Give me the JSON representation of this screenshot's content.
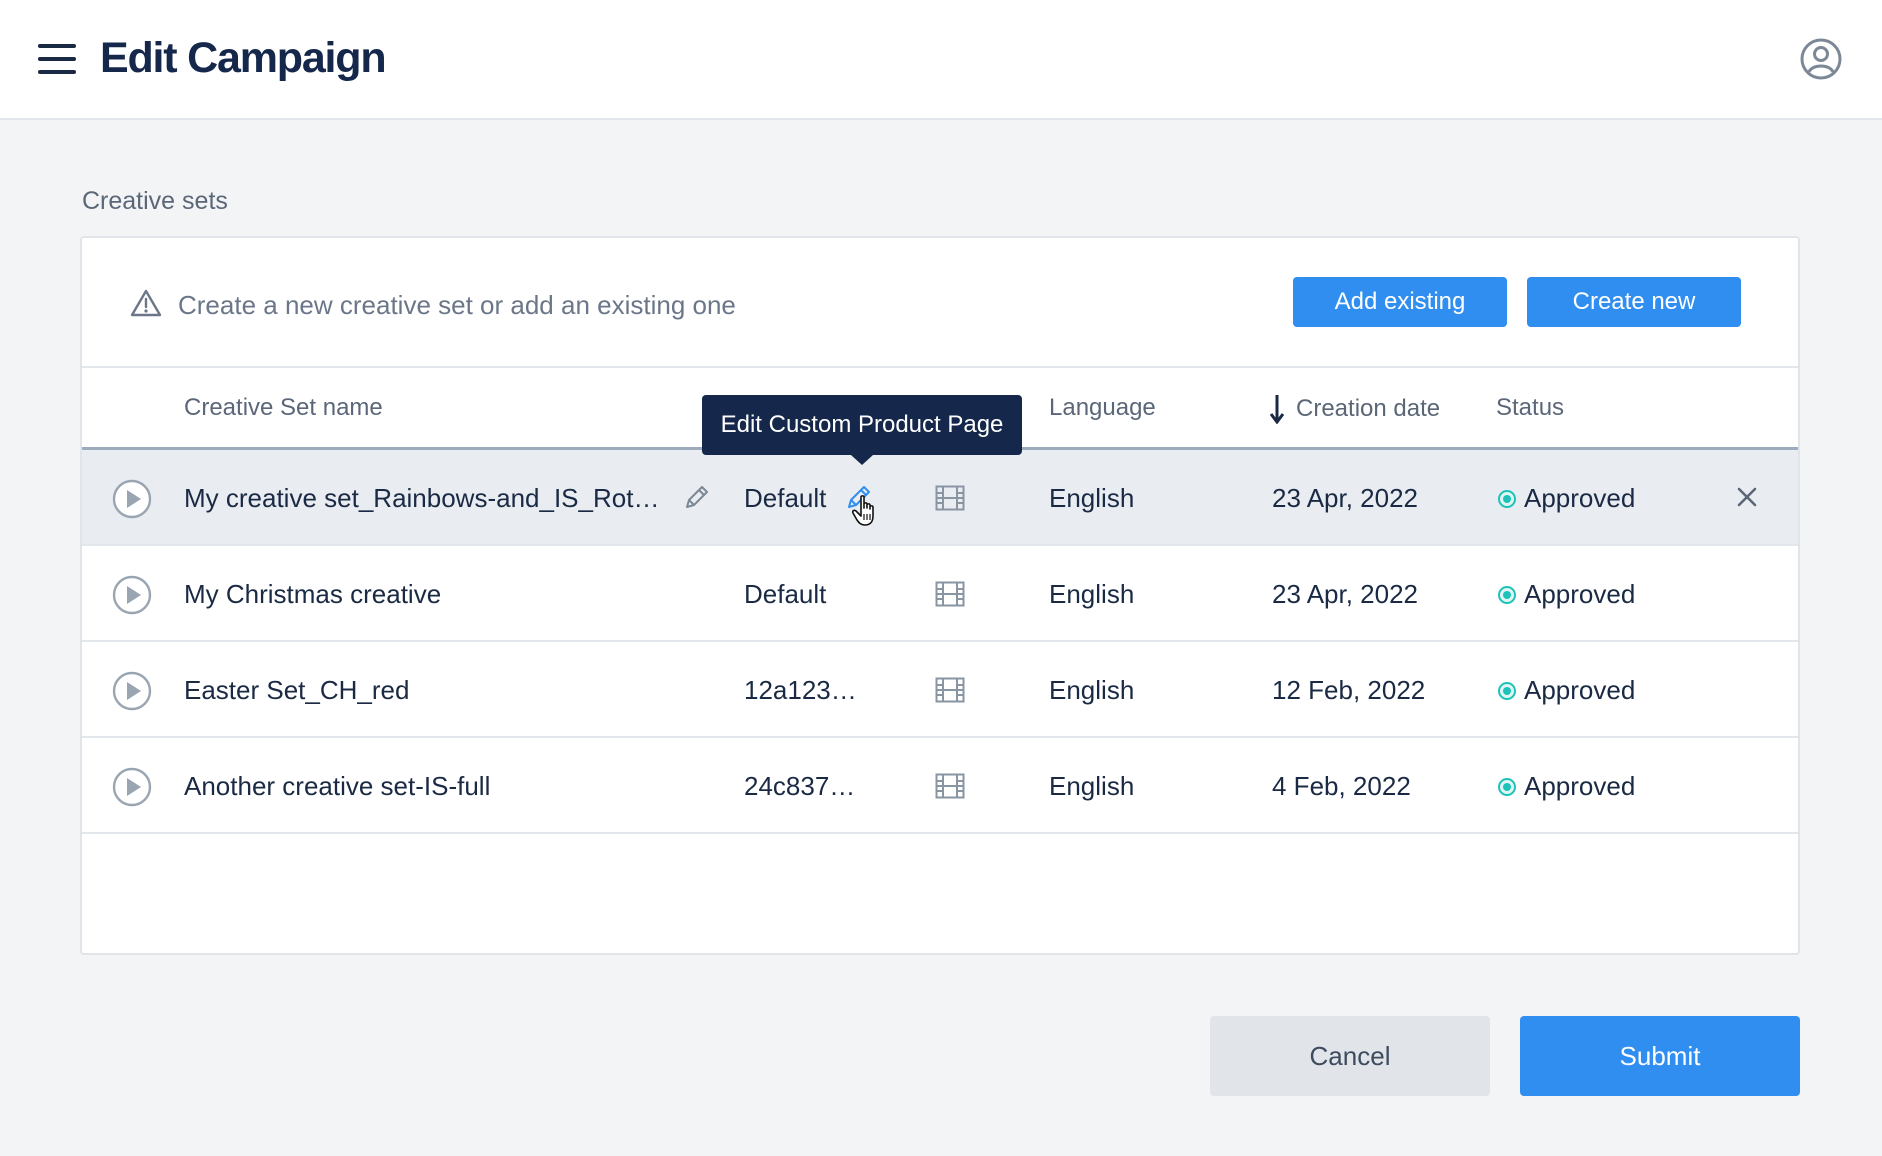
{
  "header": {
    "title": "Edit Campaign",
    "menu_icon": "hamburger-menu-icon",
    "user_icon": "user-account-icon"
  },
  "section": {
    "label": "Creative sets"
  },
  "notice": {
    "icon": "warning-icon",
    "text": "Create a new creative set or add an existing one",
    "add_existing_label": "Add existing",
    "create_new_label": "Create new"
  },
  "table": {
    "columns": {
      "name": "Creative Set name",
      "language": "Language",
      "creation_date": "Creation date",
      "status": "Status"
    },
    "sort": {
      "column": "creation_date",
      "direction": "descending"
    },
    "rows": [
      {
        "name": "My creative set_Rainbows-and_IS_Rot…",
        "cpp": "Default",
        "language": "English",
        "creation_date": "23 Apr, 2022",
        "status": "Approved"
      },
      {
        "name": "My Christmas creative",
        "cpp": "Default",
        "language": "English",
        "creation_date": "23 Apr, 2022",
        "status": "Approved"
      },
      {
        "name": "Easter Set_CH_red",
        "cpp": "12a123…",
        "language": "English",
        "creation_date": "12 Feb, 2022",
        "status": "Approved"
      },
      {
        "name": "Another creative set-IS-full",
        "cpp": "24c837…",
        "language": "English",
        "creation_date": "4 Feb, 2022",
        "status": "Approved"
      }
    ],
    "hovered_row": 0
  },
  "tooltip": {
    "text": "Edit Custom Product Page"
  },
  "footer": {
    "cancel_label": "Cancel",
    "submit_label": "Submit"
  },
  "colors": {
    "accent": "#2f8ef0",
    "title": "#15284b",
    "status_approved": "#1ec3b8",
    "row_hover": "#e9edf1"
  }
}
